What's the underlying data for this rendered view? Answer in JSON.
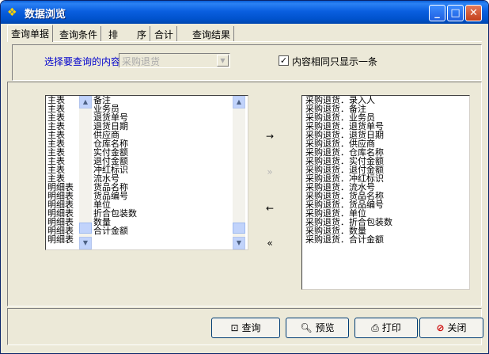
{
  "window": {
    "title": "数据浏览",
    "title_icon": "app-icon",
    "controls": {
      "minimize": "_",
      "maximize": "□",
      "close": "✕"
    }
  },
  "tabs": [
    {
      "label": "查询单据",
      "active": true
    },
    {
      "label": "查询条件",
      "active": false
    },
    {
      "label": "排　　序",
      "active": false
    },
    {
      "label": "合计",
      "active": false
    },
    {
      "label": "查询结果",
      "active": false
    }
  ],
  "query": {
    "label": "选择要查询的内容：",
    "combo_value": "采购退货",
    "dedupe_checked": true,
    "dedupe_label": "内容相同只显示一条"
  },
  "left_list": {
    "categories": [
      "主表",
      "主表",
      "主表",
      "主表",
      "主表",
      "主表",
      "主表",
      "主表",
      "主表",
      "主表",
      "明细表",
      "明细表",
      "明细表",
      "明细表",
      "明细表",
      "明细表",
      "明细表"
    ],
    "fields": [
      "备注",
      "业务员",
      "退货单号",
      "退货日期",
      "供应商",
      "仓库名称",
      "实付金额",
      "退付金额",
      "冲红标识",
      "流水号",
      "货品名称",
      "货品编号",
      "单位",
      "折合包装数",
      "数量",
      "合计金额"
    ]
  },
  "transfer": {
    "add": "→",
    "add_all": "»",
    "remove": "←",
    "remove_all": "«"
  },
  "right_list": {
    "items": [
      "采购退货．录入人",
      "采购退货．备注",
      "采购退货．业务员",
      "采购退货．退货单号",
      "采购退货．退货日期",
      "采购退货．供应商",
      "采购退货．仓库名称",
      "采购退货．实付金额",
      "采购退货．退付金额",
      "采购退货．冲红标识",
      "采购退货．流水号",
      "采购退货．货品名称",
      "采购退货．货品编号",
      "采购退货．单位",
      "采购退货．折合包装数",
      "采购退货．数量",
      "采购退货．合计金额"
    ]
  },
  "buttons": {
    "query": "查询",
    "preview": "预览",
    "print": "打印",
    "close": "关闭"
  }
}
